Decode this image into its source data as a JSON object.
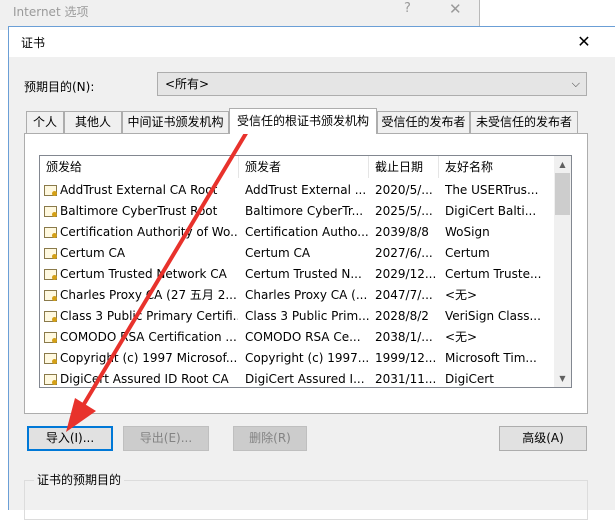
{
  "background_window": {
    "title": "Internet 选项",
    "help": "?",
    "close": "✕"
  },
  "dialog": {
    "title": "证书",
    "close": "✕",
    "purpose_label": "预期目的(N):",
    "purpose_value": "<所有>",
    "tabs": [
      {
        "label": "个人",
        "active": false
      },
      {
        "label": "其他人",
        "active": false
      },
      {
        "label": "中间证书颁发机构",
        "active": false
      },
      {
        "label": "受信任的根证书颁发机构",
        "active": true
      },
      {
        "label": "受信任的发布者",
        "active": false
      },
      {
        "label": "未受信任的发布者",
        "active": false
      }
    ],
    "columns": [
      "颁发给",
      "颁发者",
      "截止日期",
      "友好名称"
    ],
    "rows": [
      [
        "AddTrust External CA Root",
        "AddTrust External ...",
        "2020/5/...",
        "The USERTrus..."
      ],
      [
        "Baltimore CyberTrust Root",
        "Baltimore CyberTr...",
        "2025/5/...",
        "DigiCert Balti..."
      ],
      [
        "Certification Authority of Wo...",
        "Certification Autho...",
        "2039/8/8",
        "WoSign"
      ],
      [
        "Certum CA",
        "Certum CA",
        "2027/6/...",
        "Certum"
      ],
      [
        "Certum Trusted Network CA",
        "Certum Trusted N...",
        "2029/12...",
        "Certum Truste..."
      ],
      [
        "Charles Proxy CA (27 五月 2...",
        "Charles Proxy CA (...",
        "2047/7/...",
        "<无>"
      ],
      [
        "Class 3 Public Primary Certifi...",
        "Class 3 Public Prim...",
        "2028/8/2",
        "VeriSign Class..."
      ],
      [
        "COMODO RSA Certification ...",
        "COMODO RSA Ce...",
        "2038/1/...",
        "<无>"
      ],
      [
        "Copyright (c) 1997 Microsof...",
        "Copyright (c) 1997...",
        "1999/12...",
        "Microsoft Tim..."
      ],
      [
        "DigiCert Assured ID Root CA",
        "DigiCert Assured I...",
        "2031/11...",
        "DigiCert"
      ]
    ],
    "buttons": {
      "import": "导入(I)...",
      "export": "导出(E)...",
      "remove": "删除(R)",
      "advanced": "高级(A)"
    },
    "purpose_group_label": "证书的预期目的"
  },
  "colors": {
    "annotation_arrow": "#e8322c",
    "focus_border": "#0078d7"
  }
}
